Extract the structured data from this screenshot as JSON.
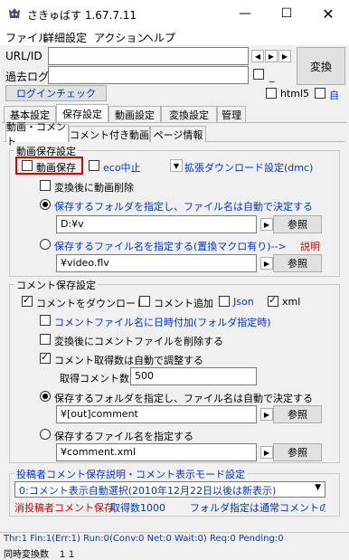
{
  "window": {
    "title": "さきゅばす 1.67.7.11",
    "minimize_icon": "minimize-icon",
    "maximize_icon": "maximize-icon",
    "close_icon": "close-icon"
  },
  "menu": [
    "ファイル",
    "詳細設定",
    "アクション",
    "ヘルプ"
  ],
  "top": {
    "url_label": "URL/ID",
    "url_value": "",
    "past_log_label": "過去ログ",
    "past_log_value": "",
    "convert_button": "変換",
    "login_check_button": "ログインチェック",
    "html5_label": "html5",
    "auto_label": "自",
    "arrow_left": "◀",
    "arrow_right": "▶"
  },
  "main_tabs": [
    "基本設定",
    "保存設定",
    "動画設定",
    "変換設定",
    "管理"
  ],
  "main_tab_active": "保存設定",
  "sub_tabs": [
    "動画・コメント",
    "コメント付き動画",
    "ページ情報"
  ],
  "video_save": {
    "group_title": "動画保存設定",
    "save_video_label": "動画保存",
    "eco_label": "eco中止",
    "ext_download_label": "拡張ダウンロード設定(dmc)",
    "delete_after_label": "変換後に動画削除",
    "folder_radio_label": "保存するフォルダを指定し、ファイル名は自動で決定する",
    "folder_value": "D:¥v",
    "browse_label": "参照",
    "file_radio_label": "保存するファイル名を指定する(置換マクロ有り)-->",
    "explain_label": "説明",
    "file_value": "¥video.flv"
  },
  "comment_save": {
    "group_title": "コメント保存設定",
    "download_label": "コメントをダウンロード",
    "append_label": "コメント追加",
    "json_label": "Json",
    "xml_label": "xml",
    "date_label": "コメントファイル名に日時付加(フォルダ指定時)",
    "delete_after_label": "変換後にコメントファイルを削除する",
    "auto_count_label": "コメント取得数は自動で調整する",
    "count_label": "取得コメント数",
    "count_value": "500",
    "folder_radio_label": "保存するフォルダを指定し、ファイル名は自動で決定する",
    "folder_value": "¥[out]comment",
    "browse_label": "参照",
    "file_radio_label": "保存するファイル名を指定する",
    "file_value": "¥comment.xml"
  },
  "poster": {
    "group_title": "投稿者コメント保存説明・コメント表示モード設定",
    "mode_value": "0:コメント表示自動選択(2010年12月22日以後は新表示)",
    "note1": "消投稿者コメント保存",
    "note2": "取得数1000",
    "note3": "フォルダ指定は通常コメントの設..."
  },
  "status": {
    "line1": "Thr:1 Fin:1(Err:1) Run:0(Conv:0 Net:0 Wait:0) Req:0 Pending:0",
    "line2": "同時変換数　１１"
  }
}
